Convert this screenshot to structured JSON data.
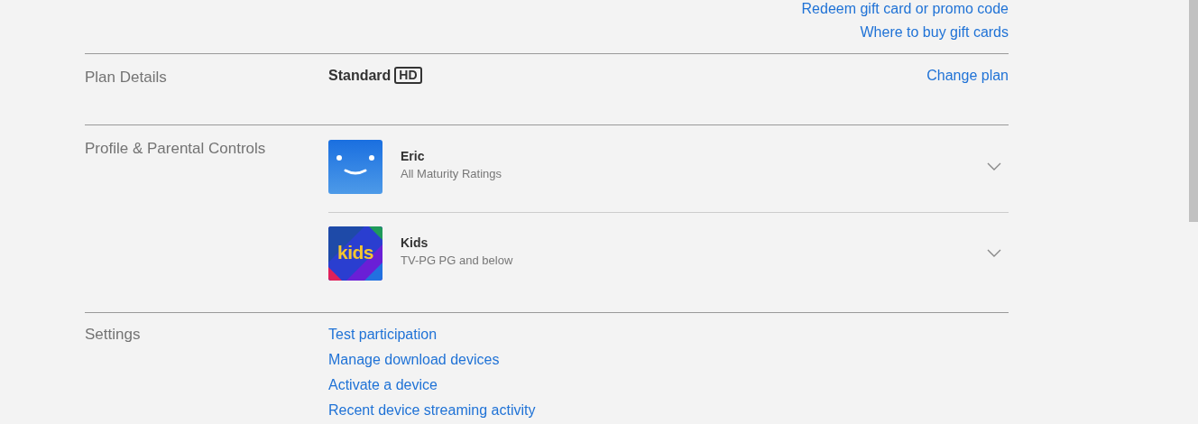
{
  "top_links": [
    "Redeem gift card or promo code",
    "Where to buy gift cards"
  ],
  "plan": {
    "label": "Plan Details",
    "name": "Standard",
    "badge": "HD",
    "action": "Change plan"
  },
  "profiles": {
    "label": "Profile & Parental Controls",
    "items": [
      {
        "name": "Eric",
        "rating": "All Maturity Ratings",
        "avatar": {
          "kind": "smile"
        },
        "expanded": false
      },
      {
        "name": "Kids",
        "rating": "TV-PG PG and below",
        "avatar": {
          "kind": "kids",
          "text": "kids"
        },
        "expanded": false
      }
    ]
  },
  "settings": {
    "label": "Settings",
    "links": [
      "Test participation",
      "Manage download devices",
      "Activate a device",
      "Recent device streaming activity"
    ]
  }
}
